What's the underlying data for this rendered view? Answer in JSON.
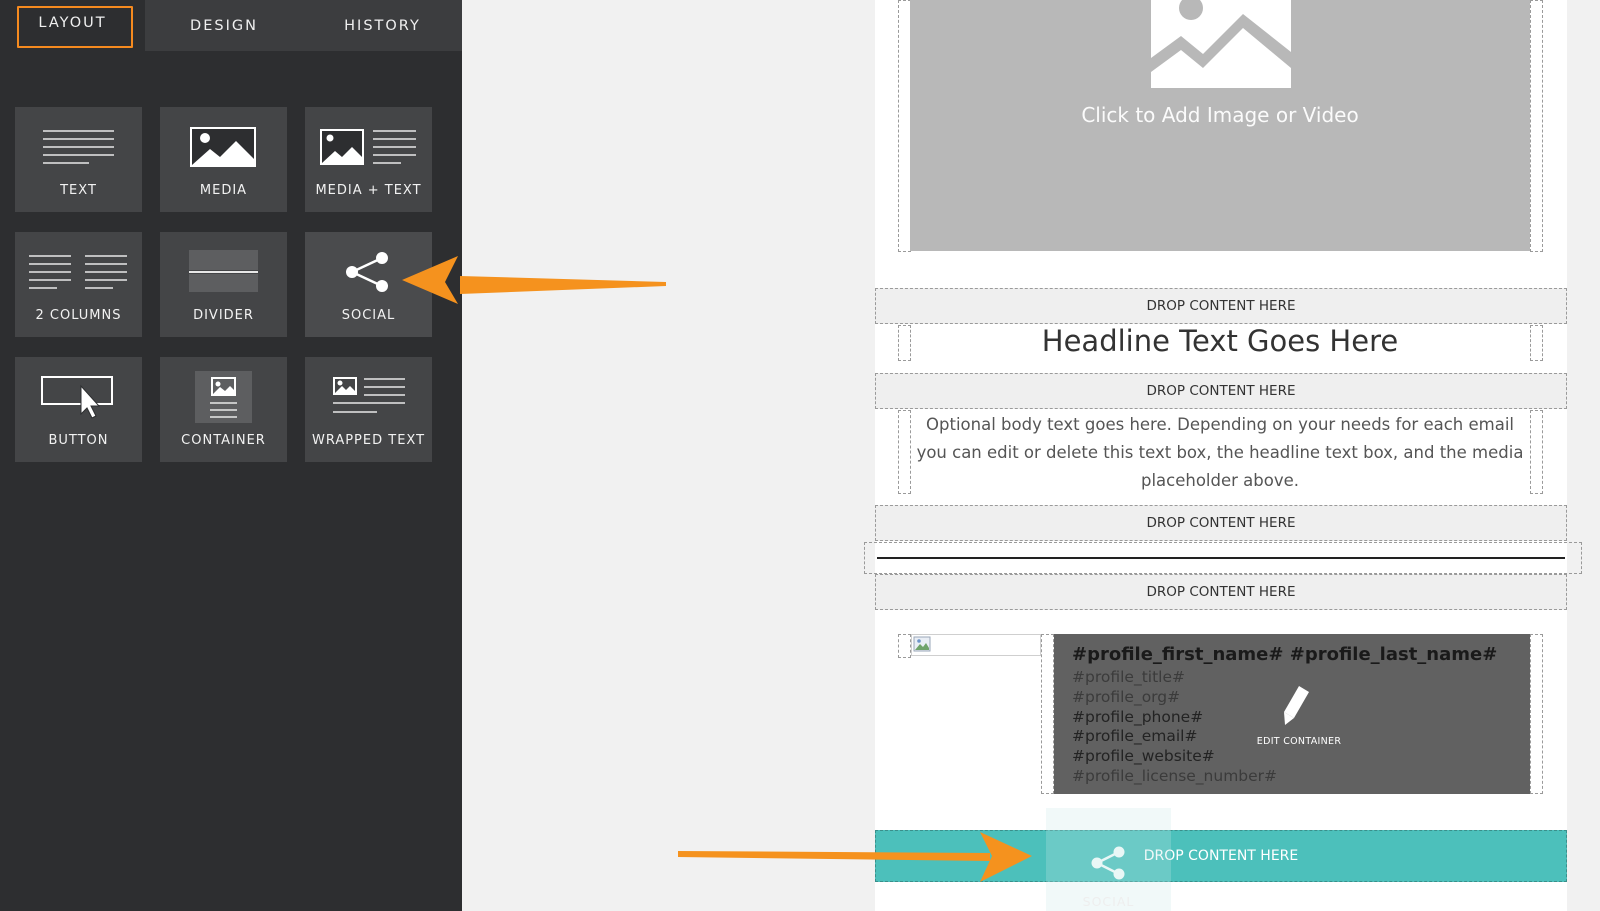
{
  "tabs": [
    {
      "label": "LAYOUT"
    },
    {
      "label": "DESIGN"
    },
    {
      "label": "HISTORY"
    }
  ],
  "tiles": [
    {
      "label": "TEXT",
      "icon": "text-lines-icon"
    },
    {
      "label": "MEDIA",
      "icon": "image-icon"
    },
    {
      "label": "MEDIA + TEXT",
      "icon": "image-text-icon"
    },
    {
      "label": "2 COLUMNS",
      "icon": "two-columns-icon"
    },
    {
      "label": "DIVIDER",
      "icon": "divider-icon"
    },
    {
      "label": "SOCIAL",
      "icon": "share-icon"
    },
    {
      "label": "BUTTON",
      "icon": "button-cursor-icon"
    },
    {
      "label": "CONTAINER",
      "icon": "container-icon"
    },
    {
      "label": "WRAPPED TEXT",
      "icon": "wrapped-text-icon"
    }
  ],
  "canvas": {
    "media_caption": "Click to Add Image or Video",
    "drop_label": "DROP CONTENT HERE",
    "headline": "Headline Text Goes Here",
    "body_text": "Optional body text goes here. Depending on your needs for each email you can edit or delete this text box, the headline text box, and the media placeholder above.",
    "profile": {
      "name": "#profile_first_name# #profile_last_name#",
      "title": "#profile_title#",
      "org": "#profile_org#",
      "phone": "#profile_phone#",
      "email": "#profile_email#",
      "website": "#profile_website#",
      "license": "#profile_license_number#",
      "edit_label": "EDIT CONTAINER"
    },
    "social_drop_label": "DROP CONTENT HERE",
    "dragging_label": "SOCIAL"
  },
  "colors": {
    "accent": "#f58a1f",
    "sidebar_bg": "#2d2e30",
    "tile_bg": "#444547",
    "social_drop": "#4cc0bb"
  }
}
